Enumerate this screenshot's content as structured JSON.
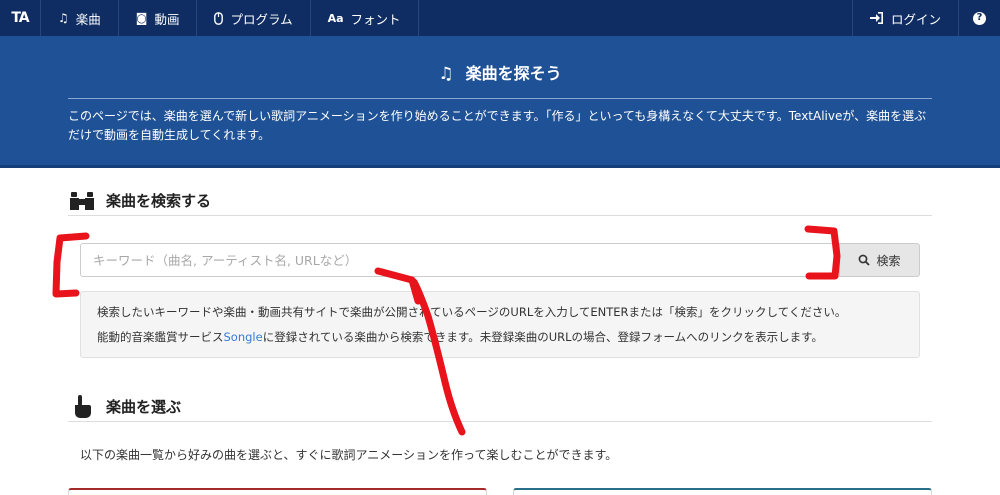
{
  "nav": {
    "logo": "TA",
    "items": [
      {
        "icon": "music-note-icon",
        "glyph": "♫",
        "label": "楽曲"
      },
      {
        "icon": "camera-icon",
        "glyph": "◙",
        "label": "動画"
      },
      {
        "icon": "mouse-icon",
        "glyph": "🖱",
        "label": "プログラム"
      },
      {
        "icon": "font-icon",
        "glyph": "Aa",
        "label": "フォント"
      }
    ],
    "login_label": "ログイン",
    "help_glyph": "?"
  },
  "hero": {
    "title": "楽曲を探そう",
    "description": "このページでは、楽曲を選んで新しい歌詞アニメーションを作り始めることができます。「作る」といっても身構えなくて大丈夫です。TextAliveが、楽曲を選ぶだけで動画を自動生成してくれます。"
  },
  "search_section": {
    "heading": "楽曲を検索する",
    "placeholder": "キーワード（曲名, アーティスト名, URLなど）",
    "button_label": "検索",
    "info_line1": "検索したいキーワードや楽曲・動画共有サイトで楽曲が公開されているページのURLを入力してENTERまたは「検索」をクリックしてください。",
    "info_line2_before": "能動的音楽鑑賞サービス",
    "info_line2_link": "Songle",
    "info_line2_after": "に登録されている楽曲から検索できます。未登録楽曲のURLの場合、登録フォームへのリンクを表示します。"
  },
  "pick_section": {
    "heading": "楽曲を選ぶ",
    "description": "以下の楽曲一覧から好みの曲を選ぶと、すぐに歌詞アニメーションを作って楽しむことができます。"
  },
  "annotation_color": "#e8131b",
  "colors": {
    "nav_bg": "#0f2d63",
    "hero_bg": "#1f5196",
    "link": "#3a7bd5"
  }
}
